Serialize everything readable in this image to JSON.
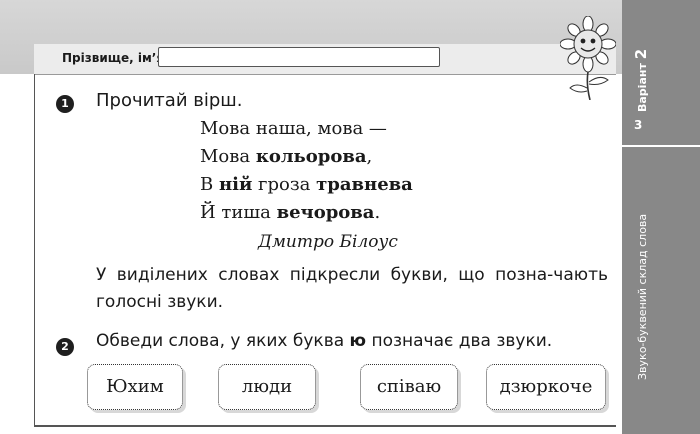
{
  "header": {
    "name_label": "Прізвище, ім’я:",
    "name_value": ""
  },
  "sidebar": {
    "variant_label": "Варіант",
    "variant_number": "2",
    "page_number": "3",
    "topic": "Звуко-буквений склад слова"
  },
  "task1": {
    "number": "1",
    "title": "Прочитай вірш.",
    "poem": [
      {
        "parts": [
          {
            "text": "Мова наша, мова —",
            "bold": false
          }
        ]
      },
      {
        "parts": [
          {
            "text": "Мова ",
            "bold": false
          },
          {
            "text": "кольорова",
            "bold": true
          },
          {
            "text": ",",
            "bold": false
          }
        ]
      },
      {
        "parts": [
          {
            "text": "В ",
            "bold": false
          },
          {
            "text": "ній",
            "bold": true
          },
          {
            "text": " гроза ",
            "bold": false
          },
          {
            "text": "травнева",
            "bold": true
          }
        ]
      },
      {
        "parts": [
          {
            "text": "Й тиша ",
            "bold": false
          },
          {
            "text": "вечорова",
            "bold": true
          },
          {
            "text": ".",
            "bold": false
          }
        ]
      }
    ],
    "author": "Дмитро Білоус",
    "instruction": "У виділених словах підкресли букви, що позна-чають голосні звуки."
  },
  "task2": {
    "number": "2",
    "text_before": "Обведи слова, у яких буква ",
    "letter": "ю",
    "text_after": " позначає два звуки.",
    "words": [
      "Юхим",
      "люди",
      "співаю",
      "дзюркоче"
    ]
  },
  "colors": {
    "sidebar": "#888888",
    "header_band": "#cfcfcf",
    "badge": "#1f1f1f"
  },
  "icons": {
    "mascot": "sunflower-mascot-icon"
  }
}
